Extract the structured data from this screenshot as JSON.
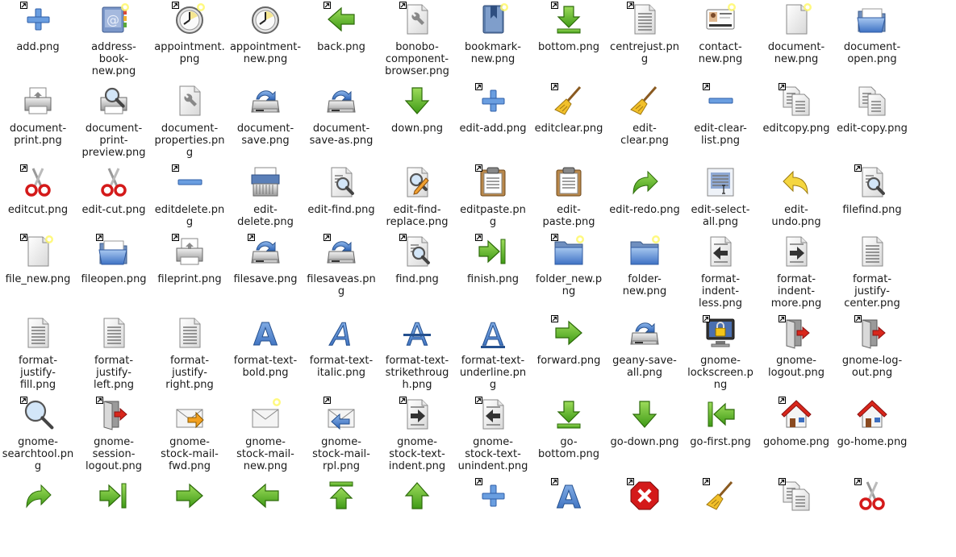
{
  "files": [
    {
      "label": "add.png",
      "icon": "plus-icon",
      "link": true
    },
    {
      "label": "address-\nbook-\nnew.png",
      "icon": "address-book-icon",
      "star": true
    },
    {
      "label": "appointment.\npng",
      "icon": "clock-icon",
      "link": true,
      "star": true
    },
    {
      "label": "appointment-\nnew.png",
      "icon": "clock-icon"
    },
    {
      "label": "back.png",
      "icon": "arrow-left-icon",
      "link": true
    },
    {
      "label": "bonobo-\ncomponent-\nbrowser.png",
      "icon": "document-wrench-icon",
      "link": true
    },
    {
      "label": "bookmark-\nnew.png",
      "icon": "bookmark-icon",
      "star": true
    },
    {
      "label": "bottom.png",
      "icon": "arrow-bottom-icon",
      "link": true
    },
    {
      "label": "centrejust.pn\ng",
      "icon": "text-lines-icon",
      "link": true
    },
    {
      "label": "contact-\nnew.png",
      "icon": "contact-card-icon",
      "star": true
    },
    {
      "label": "document-\nnew.png",
      "icon": "document-new-icon",
      "star": true
    },
    {
      "label": "document-\nopen.png",
      "icon": "folder-open-icon"
    },
    {
      "label": "document-\nprint.png",
      "icon": "printer-icon"
    },
    {
      "label": "document-\nprint-\npreview.png",
      "icon": "print-preview-icon"
    },
    {
      "label": "document-\nproperties.pn\ng",
      "icon": "document-wrench-icon"
    },
    {
      "label": "document-\nsave.png",
      "icon": "save-drive-icon"
    },
    {
      "label": "document-\nsave-as.png",
      "icon": "save-drive-icon"
    },
    {
      "label": "down.png",
      "icon": "arrow-down-icon"
    },
    {
      "label": "edit-add.png",
      "icon": "plus-icon",
      "link": true
    },
    {
      "label": "editclear.png",
      "icon": "broom-icon",
      "link": true
    },
    {
      "label": "edit-\nclear.png",
      "icon": "broom-icon"
    },
    {
      "label": "edit-clear-\nlist.png",
      "icon": "minus-icon",
      "link": true
    },
    {
      "label": "editcopy.png",
      "icon": "copy-icon",
      "link": true
    },
    {
      "label": "edit-copy.png",
      "icon": "copy-icon"
    },
    {
      "label": "editcut.png",
      "icon": "scissors-icon",
      "link": true
    },
    {
      "label": "edit-cut.png",
      "icon": "scissors-icon"
    },
    {
      "label": "editdelete.pn\ng",
      "icon": "minus-icon",
      "link": true
    },
    {
      "label": "edit-\ndelete.png",
      "icon": "shredder-icon"
    },
    {
      "label": "edit-find.png",
      "icon": "document-magnifier-icon"
    },
    {
      "label": "edit-find-\nreplace.png",
      "icon": "find-replace-icon"
    },
    {
      "label": "editpaste.pn\ng",
      "icon": "clipboard-icon",
      "link": true
    },
    {
      "label": "edit-\npaste.png",
      "icon": "clipboard-icon"
    },
    {
      "label": "edit-redo.png",
      "icon": "redo-arrow-icon"
    },
    {
      "label": "edit-select-\nall.png",
      "icon": "select-all-icon"
    },
    {
      "label": "edit-\nundo.png",
      "icon": "undo-arrow-icon"
    },
    {
      "label": "filefind.png",
      "icon": "document-magnifier-icon",
      "link": true
    },
    {
      "label": "file_new.png",
      "icon": "document-new-icon",
      "link": true,
      "star": true
    },
    {
      "label": "fileopen.png",
      "icon": "folder-open-icon",
      "link": true
    },
    {
      "label": "fileprint.png",
      "icon": "printer-icon",
      "link": true
    },
    {
      "label": "filesave.png",
      "icon": "save-drive-icon",
      "link": true
    },
    {
      "label": "filesaveas.pn\ng",
      "icon": "save-drive-icon",
      "link": true
    },
    {
      "label": "find.png",
      "icon": "document-magnifier-icon",
      "link": true
    },
    {
      "label": "finish.png",
      "icon": "arrow-right-bar-icon",
      "link": true
    },
    {
      "label": "folder_new.p\nng",
      "icon": "folder-icon",
      "link": true,
      "star": true
    },
    {
      "label": "folder-\nnew.png",
      "icon": "folder-icon",
      "star": true
    },
    {
      "label": "format-\nindent-\nless.png",
      "icon": "indent-less-icon"
    },
    {
      "label": "format-\nindent-\nmore.png",
      "icon": "indent-more-icon"
    },
    {
      "label": "format-\njustify-\ncenter.png",
      "icon": "text-lines-icon"
    },
    {
      "label": "format-\njustify-\nfill.png",
      "icon": "text-lines-icon"
    },
    {
      "label": "format-\njustify-\nleft.png",
      "icon": "text-lines-icon"
    },
    {
      "label": "format-\njustify-\nright.png",
      "icon": "text-lines-icon"
    },
    {
      "label": "format-text-\nbold.png",
      "icon": "letter-a-bold-icon"
    },
    {
      "label": "format-text-\nitalic.png",
      "icon": "letter-a-italic-icon"
    },
    {
      "label": "format-text-\nstrikethroug\nh.png",
      "icon": "letter-a-strike-icon"
    },
    {
      "label": "format-text-\nunderline.pn\ng",
      "icon": "letter-a-underline-icon"
    },
    {
      "label": "forward.png",
      "icon": "arrow-right-icon",
      "link": true
    },
    {
      "label": "geany-save-\nall.png",
      "icon": "save-drive-icon"
    },
    {
      "label": "gnome-\nlockscreen.p\nng",
      "icon": "lock-screen-icon",
      "link": true
    },
    {
      "label": "gnome-\nlogout.png",
      "icon": "logout-door-icon",
      "link": true
    },
    {
      "label": "gnome-log-\nout.png",
      "icon": "logout-door-icon",
      "link": true
    },
    {
      "label": "gnome-\nsearchtool.pn\ng",
      "icon": "magnifier-icon",
      "link": true
    },
    {
      "label": "gnome-\nsession-\nlogout.png",
      "icon": "logout-door-icon",
      "link": true
    },
    {
      "label": "gnome-\nstock-mail-\nfwd.png",
      "icon": "mail-forward-icon"
    },
    {
      "label": "gnome-\nstock-mail-\nnew.png",
      "icon": "mail-new-icon",
      "star": true
    },
    {
      "label": "gnome-\nstock-mail-\nrpl.png",
      "icon": "mail-reply-icon",
      "link": true
    },
    {
      "label": "gnome-\nstock-text-\nindent.png",
      "icon": "indent-more-icon",
      "link": true
    },
    {
      "label": "gnome-\nstock-text-\nunindent.png",
      "icon": "indent-less-icon",
      "link": true
    },
    {
      "label": "go-\nbottom.png",
      "icon": "arrow-bottom-icon"
    },
    {
      "label": "go-down.png",
      "icon": "arrow-down-icon"
    },
    {
      "label": "go-first.png",
      "icon": "arrow-first-icon"
    },
    {
      "label": "gohome.png",
      "icon": "home-icon",
      "link": true
    },
    {
      "label": "go-home.png",
      "icon": "home-icon"
    },
    {
      "label": "",
      "icon": "redo-arrow-icon"
    },
    {
      "label": "",
      "icon": "arrow-right-bar-icon"
    },
    {
      "label": "",
      "icon": "arrow-right-icon"
    },
    {
      "label": "",
      "icon": "arrow-left-icon"
    },
    {
      "label": "",
      "icon": "arrow-top-icon"
    },
    {
      "label": "",
      "icon": "arrow-up-icon"
    },
    {
      "label": "",
      "icon": "plus-icon",
      "link": true
    },
    {
      "label": "",
      "icon": "letter-a-bold-icon",
      "link": true
    },
    {
      "label": "",
      "icon": "stop-icon",
      "link": true
    },
    {
      "label": "",
      "icon": "broom-icon",
      "link": true
    },
    {
      "label": "",
      "icon": "copy-icon",
      "link": true
    },
    {
      "label": "",
      "icon": "scissors-icon",
      "link": true
    }
  ]
}
